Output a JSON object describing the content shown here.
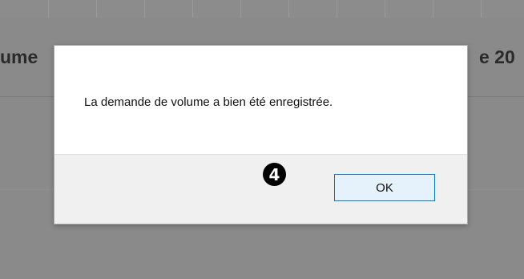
{
  "background_page": {
    "heading_left_fragment": "ume",
    "heading_right_fragment": "e 20"
  },
  "dialog": {
    "message": "La demande de volume a bien été enregistrée.",
    "ok_label": "OK"
  },
  "annotation": {
    "step_number": "4"
  },
  "colors": {
    "overlay": "#808080",
    "dialog_background": "#ffffff",
    "footer_background": "#f0f0f0",
    "button_background": "#e5f1fb",
    "button_border": "#0078d7"
  }
}
